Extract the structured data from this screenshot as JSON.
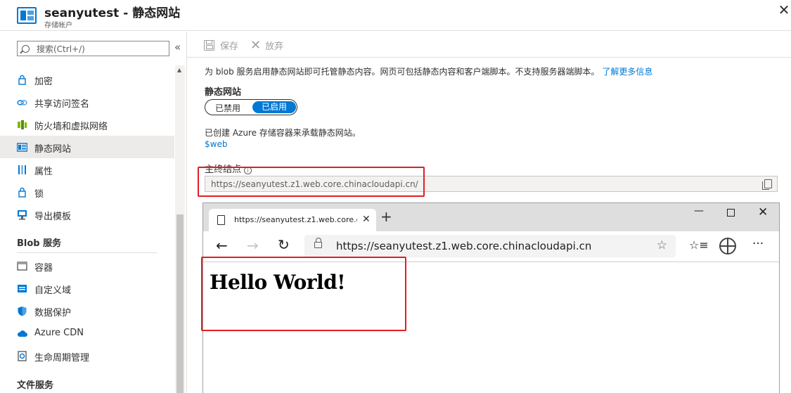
{
  "header": {
    "title": "seanyutest - 静态网站",
    "subtitle": "存储帐户",
    "close_glyph": "✕"
  },
  "sidebar": {
    "search_placeholder": "搜索(Ctrl+/)",
    "collapse_glyph": "«",
    "items": [
      {
        "label": "加密",
        "icon": "lock-icon"
      },
      {
        "label": "共享访问签名",
        "icon": "link-icon"
      },
      {
        "label": "防火墙和虚拟网络",
        "icon": "firewall-icon"
      },
      {
        "label": "静态网站",
        "icon": "website-icon",
        "active": true
      },
      {
        "label": "属性",
        "icon": "properties-icon"
      },
      {
        "label": "锁",
        "icon": "lock-icon"
      },
      {
        "label": "导出模板",
        "icon": "export-template-icon"
      }
    ],
    "blob_section": "Blob 服务",
    "blob_items": [
      {
        "label": "容器",
        "icon": "container-icon"
      },
      {
        "label": "自定义域",
        "icon": "custom-domain-icon"
      },
      {
        "label": "数据保护",
        "icon": "shield-icon"
      },
      {
        "label": "Azure CDN",
        "icon": "cloud-icon"
      },
      {
        "label": "生命周期管理",
        "icon": "lifecycle-icon"
      }
    ],
    "file_section": "文件服务"
  },
  "toolbar": {
    "save_label": "保存",
    "discard_label": "放弃"
  },
  "main": {
    "description": "为 blob 服务启用静态网站即可托管静态内容。网页可包括静态内容和客户端脚本。不支持服务器端脚本。",
    "learn_more": "了解更多信息",
    "static_website_label": "静态网站",
    "toggle_off": "已禁用",
    "toggle_on": "已启用",
    "created_text": "已创建 Azure 存储容器来承载静态网站。",
    "web_container_link": "$web",
    "endpoint_label": "主终结点",
    "endpoint_value": "https://seanyutest.z1.web.core.chinacloudapi.cn/"
  },
  "browser": {
    "tab_title": "https://seanyutest.z1.web.core.chinacloudapi.cn",
    "address": "https://seanyutest.z1.web.core.chinacloudapi.cn",
    "page_heading": "Hello World!"
  },
  "colors": {
    "accent": "#0078d4",
    "highlight_box": "#e01e25",
    "active_nav_bg": "#edebe9"
  }
}
